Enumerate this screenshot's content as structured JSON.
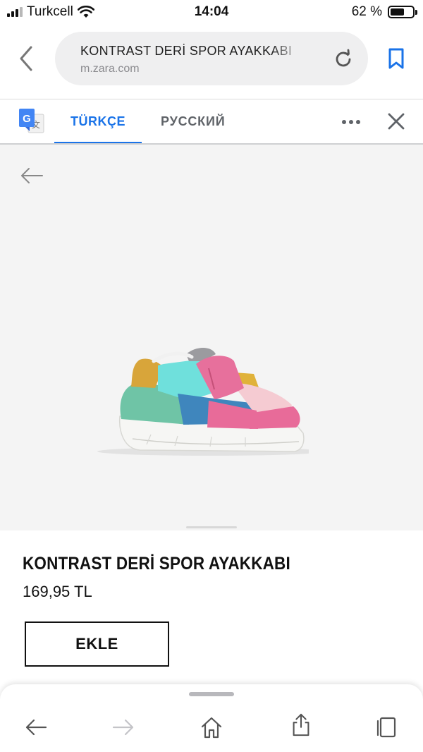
{
  "status_bar": {
    "carrier": "Turkcell",
    "time": "14:04",
    "battery_text": "62 %",
    "battery_level": 0.62
  },
  "browser": {
    "page_title": "KONTRAST DERİ SPOR AYAKKABI",
    "domain": "m.zara.com",
    "icons": [
      "chevron-left-icon",
      "reload-icon",
      "bookmark-icon"
    ]
  },
  "translate_bar": {
    "tabs": [
      {
        "label": "TÜRKÇE",
        "active": true
      },
      {
        "label": "РУССКИЙ",
        "active": false
      }
    ],
    "accent_color": "#1a73e8",
    "icons": [
      "google-translate-icon",
      "more-icon",
      "close-icon"
    ]
  },
  "product": {
    "title": "KONTRAST DERİ SPOR AYAKKABI",
    "price": "169,95 TL",
    "add_label": "EKLE"
  },
  "toolbar": {
    "icons": [
      "back-arrow-icon",
      "forward-arrow-icon",
      "home-icon",
      "share-icon",
      "tabs-icon"
    ]
  }
}
